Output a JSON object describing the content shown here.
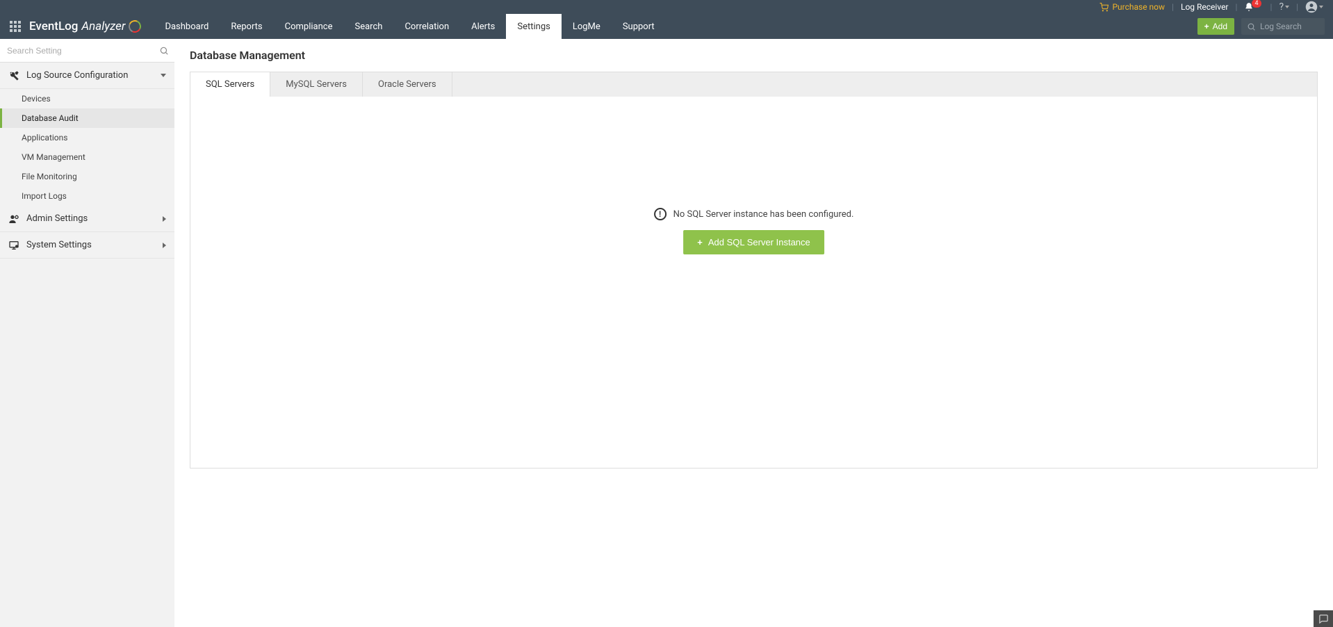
{
  "topbar": {
    "purchase_label": "Purchase now",
    "log_receiver_label": "Log Receiver",
    "notification_count": "4"
  },
  "brand": {
    "name_part1": "EventLog",
    "name_part2": "Analyzer"
  },
  "nav": {
    "items": [
      "Dashboard",
      "Reports",
      "Compliance",
      "Search",
      "Correlation",
      "Alerts",
      "Settings",
      "LogMe",
      "Support"
    ],
    "active_index": 6
  },
  "header_right": {
    "add_label": "Add",
    "log_search_label": "Log Search"
  },
  "sidebar": {
    "search_placeholder": "Search Setting",
    "sections": [
      {
        "title": "Log Source Configuration",
        "icon": "tools",
        "expanded": true,
        "items": [
          "Devices",
          "Database Audit",
          "Applications",
          "VM Management",
          "File Monitoring",
          "Import Logs"
        ],
        "active_item_index": 1
      },
      {
        "title": "Admin Settings",
        "icon": "admin",
        "expanded": false
      },
      {
        "title": "System Settings",
        "icon": "system",
        "expanded": false
      }
    ]
  },
  "main": {
    "page_title": "Database Management",
    "tabs": [
      "SQL Servers",
      "MySQL Servers",
      "Oracle Servers"
    ],
    "active_tab_index": 0,
    "empty_message": "No SQL Server instance has been configured.",
    "add_instance_label": "Add SQL Server Instance"
  }
}
